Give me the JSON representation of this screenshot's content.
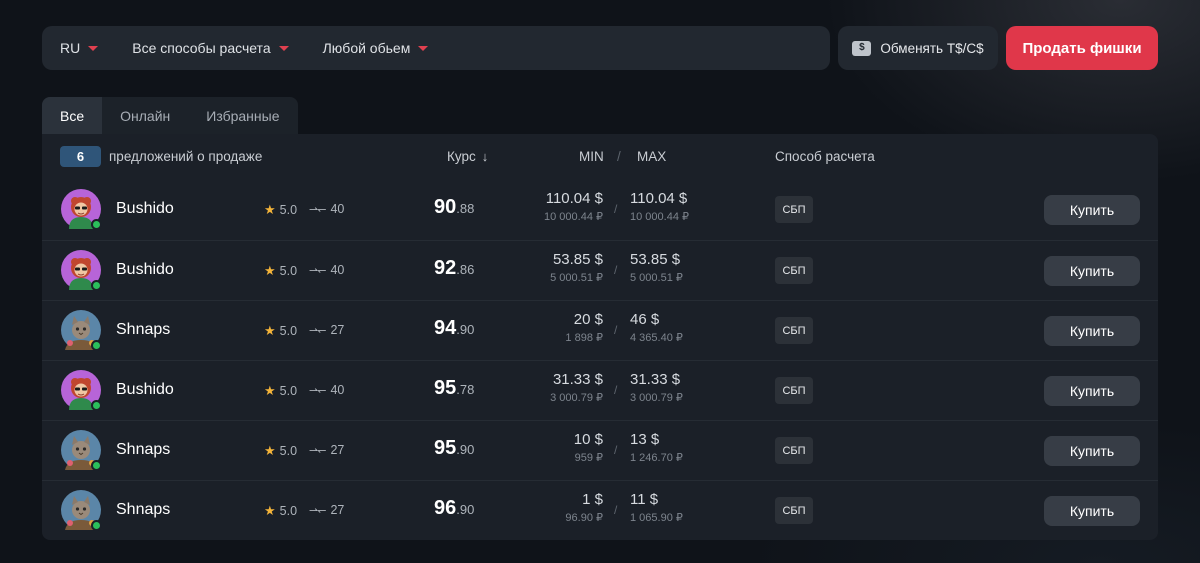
{
  "filters": {
    "region": "RU",
    "payment": "Все способы расчета",
    "volume": "Любой обьем"
  },
  "exchange_button": "Обменять T$/C$",
  "exchange_icon_text": "$",
  "sell_button": "Продать фишки",
  "tabs": [
    {
      "label": "Все",
      "active": true
    },
    {
      "label": "Онлайн",
      "active": false
    },
    {
      "label": "Избранные",
      "active": false
    }
  ],
  "header": {
    "count": "6",
    "count_label": "предложений о продаже",
    "rate": "Курс",
    "min": "MIN",
    "separator": "/",
    "max": "MAX",
    "payment_method": "Способ расчета"
  },
  "offers": [
    {
      "user": "Bushido",
      "avatar": "bushido-avatar",
      "rating": "5.0",
      "deals": "40",
      "rate_int": "90",
      "rate_dec": ".88",
      "min_usd": "110.04 $",
      "min_rub": "10 000.44 ₽",
      "max_usd": "110.04 $",
      "max_rub": "10 000.44 ₽",
      "method": "СБП",
      "buy": "Купить"
    },
    {
      "user": "Bushido",
      "avatar": "bushido-avatar",
      "rating": "5.0",
      "deals": "40",
      "rate_int": "92",
      "rate_dec": ".86",
      "min_usd": "53.85 $",
      "min_rub": "5 000.51 ₽",
      "max_usd": "53.85 $",
      "max_rub": "5 000.51 ₽",
      "method": "СБП",
      "buy": "Купить"
    },
    {
      "user": "Shnaps",
      "avatar": "shnaps-avatar",
      "rating": "5.0",
      "deals": "27",
      "rate_int": "94",
      "rate_dec": ".90",
      "min_usd": "20 $",
      "min_rub": "1 898 ₽",
      "max_usd": "46 $",
      "max_rub": "4 365.40 ₽",
      "method": "СБП",
      "buy": "Купить"
    },
    {
      "user": "Bushido",
      "avatar": "bushido-avatar",
      "rating": "5.0",
      "deals": "40",
      "rate_int": "95",
      "rate_dec": ".78",
      "min_usd": "31.33 $",
      "min_rub": "3 000.79 ₽",
      "max_usd": "31.33 $",
      "max_rub": "3 000.79 ₽",
      "method": "СБП",
      "buy": "Купить"
    },
    {
      "user": "Shnaps",
      "avatar": "shnaps-avatar",
      "rating": "5.0",
      "deals": "27",
      "rate_int": "95",
      "rate_dec": ".90",
      "min_usd": "10 $",
      "min_rub": "959 ₽",
      "max_usd": "13 $",
      "max_rub": "1 246.70 ₽",
      "method": "СБП",
      "buy": "Купить"
    },
    {
      "user": "Shnaps",
      "avatar": "shnaps-avatar",
      "rating": "5.0",
      "deals": "27",
      "rate_int": "96",
      "rate_dec": ".90",
      "min_usd": "1 $",
      "min_rub": "96.90 ₽",
      "max_usd": "11 $",
      "max_rub": "1 065.90 ₽",
      "method": "СБП",
      "buy": "Купить"
    }
  ],
  "colors": {
    "accent_red": "#e0374a",
    "badge_blue": "#2f5579",
    "online_green": "#2bbf5b",
    "star_gold": "#f4b43a"
  }
}
